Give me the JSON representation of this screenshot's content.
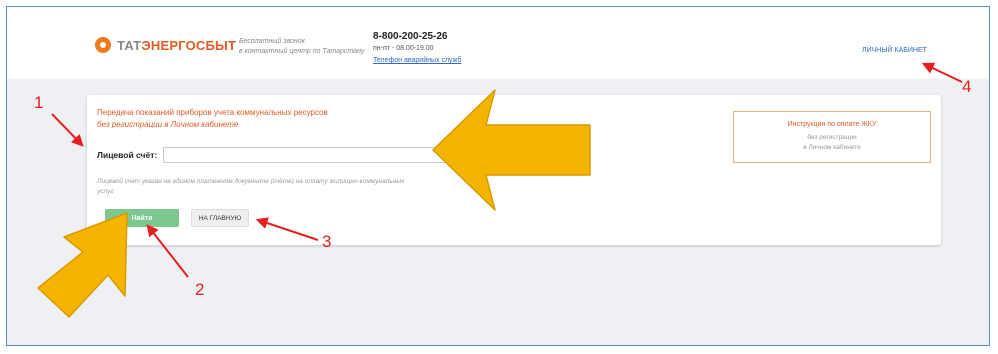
{
  "header": {
    "logo_part1": "ТАТ",
    "logo_part2": "ЭНЕРГОСБЫТ",
    "hotline_line1": "Бесплатный звонок",
    "hotline_line2": "в контактный центр по Татарстану",
    "phone": "8-800-200-25-26",
    "hours": "пн-пт - 08.00-19.00",
    "emergency_link": "Телефон аварийных служб",
    "account_link": "личный кабинет"
  },
  "form": {
    "title_line1": "Передача показаний приборов учета коммунальных ресурсов",
    "title_line2": "без регистрации в Личном кабинете",
    "account_label": "Лицевой счёт:",
    "account_value": "",
    "account_placeholder": "",
    "hint_line1": "Лицевой счет указан на едином платежном документе (счёте) на оплату жилищно-коммунальных",
    "hint_line2": "услуг",
    "find_button": "Найти",
    "home_button": "на главную"
  },
  "instruction": {
    "title": "Инструкция по оплате ЖКУ",
    "line1": "без регистрации",
    "line2": "в Личном кабинете"
  },
  "annotations": {
    "label_1": "1",
    "label_2": "2",
    "label_3": "3",
    "label_4": "4"
  },
  "colors": {
    "brand_orange": "#e35b22",
    "link_blue": "#2a6ac8",
    "button_green": "#7cc78e",
    "annotation_red": "#e61e1e",
    "pointer_yellow": "#f5b400"
  }
}
